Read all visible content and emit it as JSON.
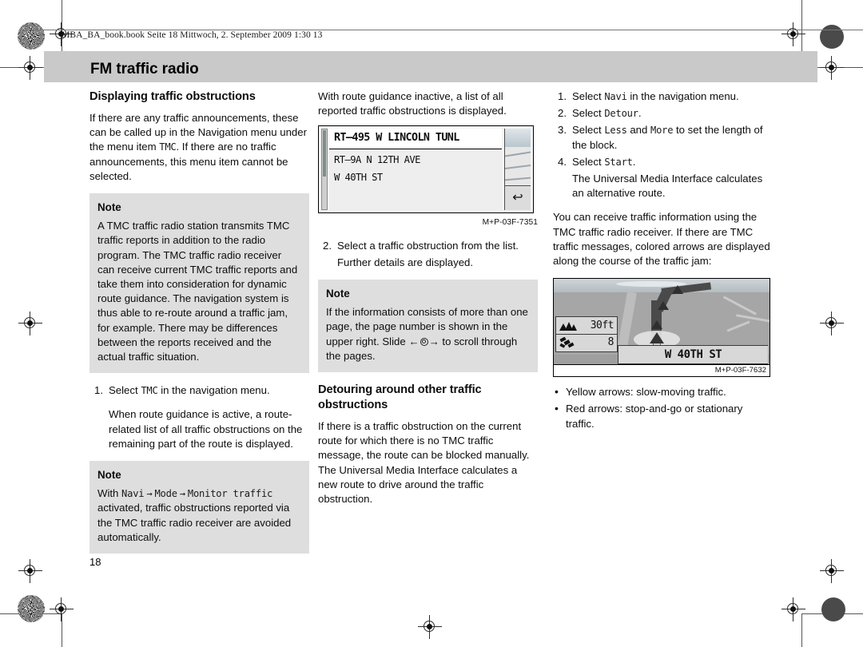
{
  "running_head": {
    "folio_line": "MBA_BA_book.book  Seite 18  Mittwoch, 2. September 2009  1:30 13",
    "chapter_title": "FM traffic radio"
  },
  "page_number": "18",
  "left_column": {
    "section_heading": "Displaying traffic obstructions",
    "intro_part1": "If there are any traffic announcements, these can be called up in the Navigation menu under the menu item ",
    "intro_mono": "TMC",
    "intro_part2": ". If there are no traffic announcements, this menu item cannot be selected.",
    "note1": {
      "title": "Note",
      "body": "A TMC traffic radio station transmits TMC traffic reports in addition to the radio program. The TMC traffic radio receiver can receive current TMC traffic reports and take them into consideration for dynamic route guidance. The navigation system is thus able to re-route around a traffic jam, for example. There may be differences between the reports received and the actual traffic situation."
    },
    "step1": {
      "num": "1.",
      "text_before": "Select ",
      "mono": "TMC",
      "text_after": " in the navigation menu."
    },
    "step1_sub": "When route guidance is active, a route-related list of all traffic obstructions on the remaining part of the route is displayed.",
    "note2": {
      "title": "Note",
      "with_label": "With ",
      "mono_navi": "Navi",
      "arrow1": "→",
      "mono_mode": "Mode",
      "arrow2": "→",
      "mono_monitor": "Monitor traffic",
      "body_after": " activated, traffic obstructions reported via the TMC traffic radio receiver are avoided automatically."
    }
  },
  "mid_column": {
    "intro": "With route guidance inactive, a list of all reported traffic obstructions is displayed.",
    "figure_list": {
      "header_row": "RT–495 W LINCOLN TUNL",
      "rows": [
        "RT–9A N 12TH AVE",
        "W 40TH ST"
      ],
      "back_icon": "↩",
      "caption": "M+P-03F-7351"
    },
    "step2": {
      "num": "2.",
      "text": "Select a traffic obstruction from the list."
    },
    "step2_sub": "Further details are displayed.",
    "note3": {
      "title": "Note",
      "body_before": "If the information consists of more than one page, the page number is shown in the upper right. Slide ",
      "slide_left": "←",
      "slide_right": "→",
      "body_after": " to scroll through the pages."
    },
    "section_heading": "Detouring around other traffic obstructions",
    "body": "If there is a traffic obstruction on the current route for which there is no TMC traffic message, the route can be blocked manually. The Universal Media Interface calculates a new route to drive around the traffic obstruction."
  },
  "right_column": {
    "steps": [
      {
        "num": "1.",
        "before": "Select ",
        "mono": "Navi",
        "after": " in the navigation menu."
      },
      {
        "num": "2.",
        "before": "Select ",
        "mono": "Detour",
        "after": "."
      },
      {
        "num": "3.",
        "before": "Select ",
        "mono": "Less",
        "mid": " and ",
        "mono2": "More",
        "after": " to set the length of the block."
      },
      {
        "num": "4.",
        "before": "Select ",
        "mono": "Start",
        "after": "."
      }
    ],
    "step4_sub": "The Universal Media Interface calculates an alternative route.",
    "body": "You can receive traffic information using the TMC traffic radio receiver. If there are TMC traffic messages, colored arrows are displayed along the course of the traffic jam:",
    "figure_map": {
      "elevation_value": "30ft",
      "satellite_value": "8",
      "street_name": "W 40TH ST",
      "caption": "M+P-03F-7632"
    },
    "bullets": [
      "Yellow arrows: slow-moving traffic.",
      "Red arrows: stop-and-go or stationary traffic."
    ]
  }
}
